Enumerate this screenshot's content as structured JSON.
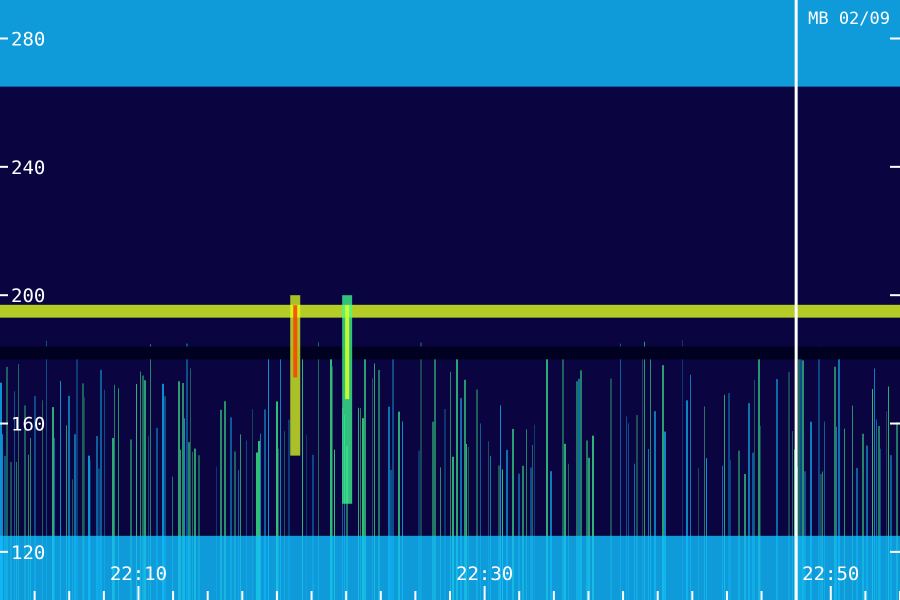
{
  "chart_data": {
    "type": "heatmap",
    "title": "",
    "station_label": "MB 02/09",
    "xlabel": "",
    "ylabel": "",
    "y_unit": "",
    "ylim": [
      105,
      292
    ],
    "xlim": [
      "22:02",
      "22:54"
    ],
    "y_ticks": [
      {
        "value": 280,
        "label": "280"
      },
      {
        "value": 240,
        "label": "240"
      },
      {
        "value": 200,
        "label": "200"
      },
      {
        "value": 160,
        "label": "160"
      },
      {
        "value": 120,
        "label": "120"
      }
    ],
    "x_ticks": [
      {
        "value": "22:10",
        "label": "22:10"
      },
      {
        "value": "22:30",
        "label": "22:30"
      },
      {
        "value": "22:50",
        "label": "22:50"
      }
    ],
    "x_minor_ticks": [
      "22:04",
      "22:06",
      "22:08",
      "22:12",
      "22:14",
      "22:16",
      "22:18",
      "22:20",
      "22:22",
      "22:24",
      "22:26",
      "22:28",
      "22:32",
      "22:34",
      "22:36",
      "22:38",
      "22:40",
      "22:42",
      "22:44",
      "22:46",
      "22:48",
      "22:52",
      "22:54"
    ],
    "marker_line": {
      "time": "22:48",
      "color": "#ffffff"
    },
    "bands": [
      {
        "y_from": 265,
        "y_to": 292,
        "intensity": 0.55
      },
      {
        "y_from": 193,
        "y_to": 197,
        "intensity": 0.85
      },
      {
        "y_from": 180,
        "y_to": 184,
        "intensity": 0.0
      },
      {
        "y_from": 105,
        "y_to": 125,
        "intensity": 0.6
      }
    ],
    "hot_events": [
      {
        "time": "22:19",
        "y_from": 150,
        "y_to": 200,
        "intensity": 1.0
      },
      {
        "time": "22:22",
        "y_from": 135,
        "y_to": 200,
        "intensity": 0.8
      }
    ],
    "colormap": [
      "#000020",
      "#1a0a70",
      "#2a20d0",
      "#1060ff",
      "#10c0ff",
      "#40ff90",
      "#e0ff20",
      "#ff4000"
    ],
    "grid": false,
    "legend": "none"
  }
}
